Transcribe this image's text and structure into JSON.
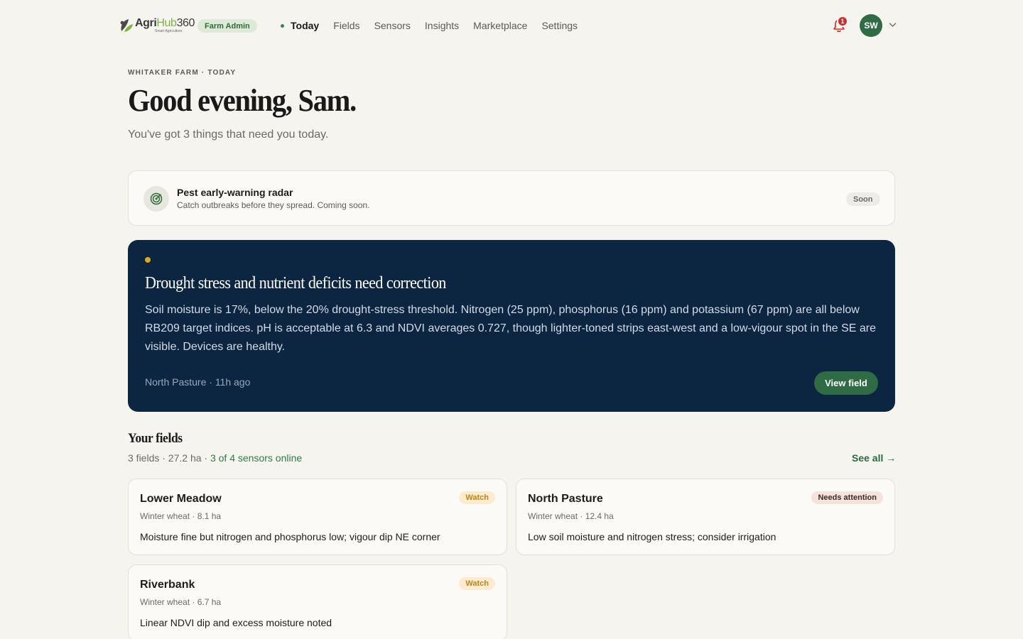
{
  "app": {
    "logo_agri": "Agri",
    "logo_hub": "Hub",
    "logo_num": "360",
    "logo_tagline": "Smart Agriculture",
    "role_badge": "Farm Admin"
  },
  "nav": {
    "items": [
      {
        "label": "Today",
        "active": true
      },
      {
        "label": "Fields",
        "active": false
      },
      {
        "label": "Sensors",
        "active": false
      },
      {
        "label": "Insights",
        "active": false
      },
      {
        "label": "Marketplace",
        "active": false
      },
      {
        "label": "Settings",
        "active": false
      }
    ],
    "notification_count": "1",
    "avatar_initials": "SW"
  },
  "header": {
    "eyebrow": "WHITAKER FARM · TODAY",
    "greeting": "Good evening, Sam.",
    "subline": "You've got 3 things that need you today."
  },
  "coming_soon": {
    "title": "Pest early-warning radar",
    "description": "Catch outbreaks before they spread. Coming soon.",
    "badge": "Soon",
    "icon": "radar-icon"
  },
  "alert": {
    "title": "Drought stress and nutrient deficits need correction",
    "body": "Soil moisture is 17%, below the 20% drought-stress threshold. Nitrogen (25 ppm), phosphorus (16 ppm) and potassium (67 ppm) are all below RB209 target indices. pH is acceptable at 6.3 and NDVI averages 0.727, though lighter-toned strips east-west and a low-vigour spot in the SE are visible. Devices are healthy.",
    "meta": "North Pasture · 11h ago",
    "button": "View field"
  },
  "fields": {
    "title": "Your fields",
    "summary": "3 fields · 27.2 ha · ",
    "sensors_online": "3 of 4 sensors online",
    "see_all": "See all →",
    "items": [
      {
        "name": "Lower Meadow",
        "crop": "Winter wheat · 8.1 ha",
        "note": "Moisture fine but nitrogen and phosphorus low; vigour dip NE corner",
        "status": "Watch"
      },
      {
        "name": "North Pasture",
        "crop": "Winter wheat · 12.4 ha",
        "note": "Low soil moisture and nitrogen stress; consider irrigation",
        "status": "Needs attention"
      },
      {
        "name": "Riverbank",
        "crop": "Winter wheat · 6.7 ha",
        "note": "Linear NDVI dip and excess moisture noted",
        "status": "Watch"
      }
    ]
  },
  "colors": {
    "background": "#f6f4ef",
    "hero": "#0c2540",
    "brand_green": "#2f6b44",
    "watch": "#c18412",
    "alert_red": "#c9302c"
  }
}
